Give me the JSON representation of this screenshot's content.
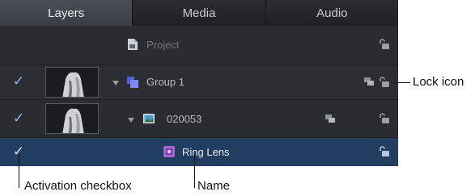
{
  "tabs": [
    {
      "label": "Layers",
      "active": true
    },
    {
      "label": "Media",
      "active": false
    },
    {
      "label": "Audio",
      "active": false
    }
  ],
  "rows": {
    "project": {
      "label": "Project"
    },
    "group": {
      "label": "Group 1",
      "checked": true
    },
    "clip": {
      "label": "020053",
      "checked": true
    },
    "ring": {
      "label": "Ring Lens",
      "checked": true,
      "selected": true
    }
  },
  "callouts": {
    "lock_icon": "Lock icon",
    "activation_checkbox": "Activation checkbox",
    "name": "Name"
  },
  "icons": {
    "checkbox": "checkmark-icon",
    "project": "project-document-icon",
    "group": "group-layers-icon",
    "clip": "image-clip-icon",
    "ring": "filter-icon",
    "lock": "lock-icon",
    "layer_options": "layer-options-icon"
  },
  "colors": {
    "panel_bg": "#2a2c31",
    "selected_row": "#213d5f",
    "check_accent": "#8fb5ef",
    "group_icon": "#6f7ee6",
    "ring_icon": "#b06ad6"
  }
}
